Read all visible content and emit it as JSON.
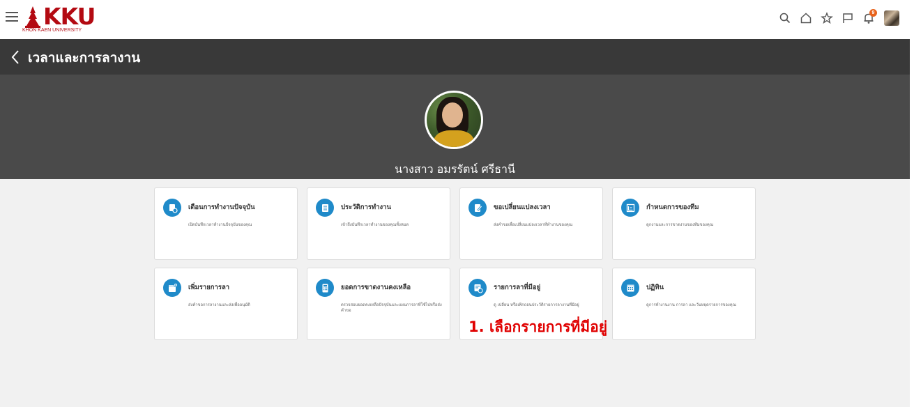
{
  "header": {
    "logo_text": "KKU",
    "logo_subtitle": "KHON KAEN UNIVERSITY",
    "notification_count": "9",
    "accent_color": "#b30a12"
  },
  "titlebar": {
    "title": "เวลาและการลางาน"
  },
  "profile": {
    "name": "นางสาว อมรรัตน์ ศรีธานี"
  },
  "tiles": [
    {
      "title": "เตือนการทำงานปัจจุบัน",
      "desc": "เปิดบันทึกเวลาทำงานปัจจุบันของคุณ",
      "icon": "report-clock-icon"
    },
    {
      "title": "ประวัติการทำงาน",
      "desc": "เข้าถึงบันทึกเวลาทำงานของคุณทั้งหมด",
      "icon": "document-list-icon"
    },
    {
      "title": "ขอเปลี่ยนแปลงเวลา",
      "desc": "ส่งคำขอเพื่อเปลี่ยนแปลงเวลาที่ทำงานของคุณ",
      "icon": "edit-document-icon"
    },
    {
      "title": "กำหนดการของทีม",
      "desc": "ดูกงานและการขาดงานของทีมของคุณ",
      "icon": "chart-icon"
    },
    {
      "title": "เพิ่มรายการลา",
      "desc": "ส่งคำขอการลางานและส่งเพื่ออนุมัติ",
      "icon": "calendar-add-icon"
    },
    {
      "title": "ยอดการขาดงานคงเหลือ",
      "desc": "ตรวจสอบยอดคงเหลือปัจจุบันและแผนการลาที่ใช้ไปหรือส่งคำขอ",
      "icon": "calculator-icon"
    },
    {
      "title": "รายการลาที่มีอยู่",
      "desc": "ดู เปลี่ยน หรือเพิกถอนประวัติรายการลางานที่มีอยู่",
      "icon": "list-clock-icon"
    },
    {
      "title": "ปฏิทิน",
      "desc": "ดูการทำงานงาน การลา และวันหยุดรายการของคุณ",
      "icon": "calendar-grid-icon"
    }
  ],
  "annotation": {
    "text": "1. เลือกรายการที่มีอยู่",
    "color": "#e00000"
  }
}
